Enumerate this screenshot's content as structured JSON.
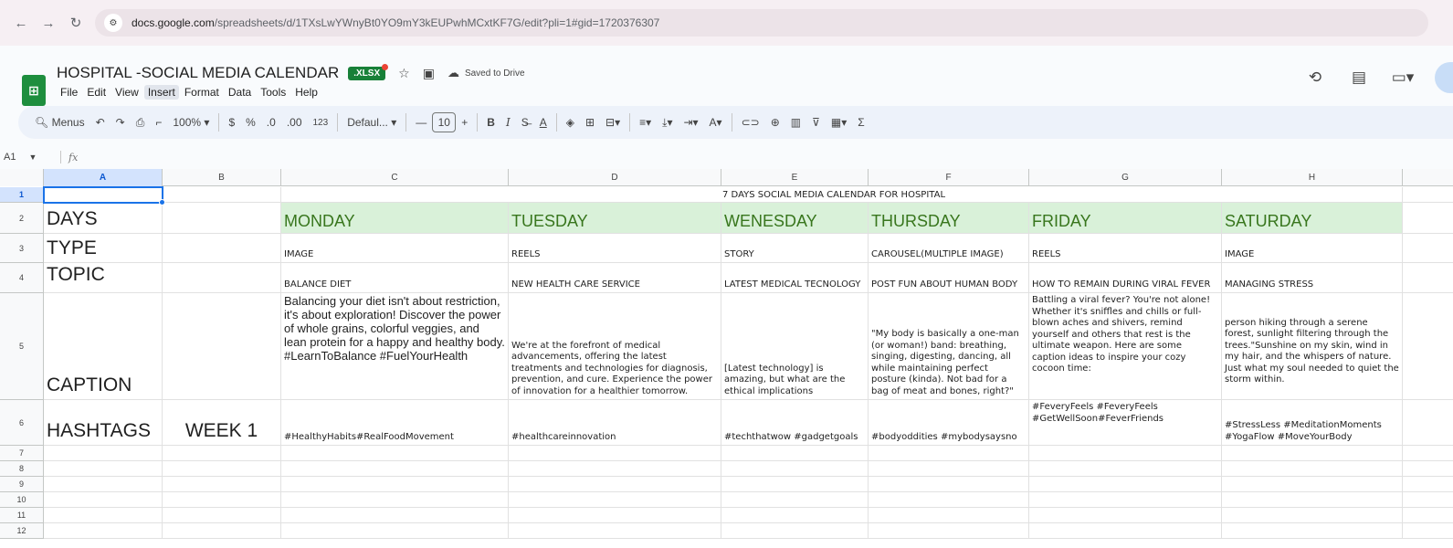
{
  "browser": {
    "url_host": "docs.google.com",
    "url_path": "/spreadsheets/d/1TXsLwYWnyBt0YO9mY3kEUPwhMCxtKF7G/edit?pli=1#gid=1720376307"
  },
  "doc": {
    "title": "HOSPITAL -SOCIAL MEDIA CALENDAR",
    "badge": ".XLSX",
    "saved_status": "Saved to Drive"
  },
  "menu": [
    "File",
    "Edit",
    "View",
    "Insert",
    "Format",
    "Data",
    "Tools",
    "Help"
  ],
  "toolbar": {
    "menus_label": "Menus",
    "zoom": "100%",
    "currency": "$",
    "percent": "%",
    "dec_decrease": ".0",
    "dec_increase": ".00",
    "number_format": "123",
    "font_name": "Defaul...",
    "font_size": "10"
  },
  "formula": {
    "cell_ref": "A1",
    "fx": "fx"
  },
  "columns": [
    "A",
    "B",
    "C",
    "D",
    "E",
    "F",
    "G",
    "H"
  ],
  "rows": [
    "1",
    "2",
    "3",
    "4",
    "5",
    "6",
    "7",
    "8",
    "9",
    "10",
    "11",
    "12"
  ],
  "sheet": {
    "title": "7 DAYS SOCIAL MEDIA CALENDAR FOR HOSPITAL",
    "labels": {
      "days": "DAYS",
      "type": "TYPE",
      "topic": "TOPIC",
      "caption": "CAPTION",
      "hashtags": "HASHTAGS",
      "week": "WEEK 1"
    },
    "days": [
      "MONDAY",
      "TUESDAY",
      "WENESDAY",
      "THURSDAY",
      "FRIDAY",
      "SATURDAY"
    ],
    "types": [
      "IMAGE",
      "REELS",
      "STORY",
      "CAROUSEL(MULTIPLE IMAGE)",
      "REELS",
      "IMAGE"
    ],
    "topics": [
      "BALANCE DIET",
      "NEW HEALTH CARE SERVICE",
      "LATEST MEDICAL TECNOLOGY",
      "POST FUN ABOUT HUMAN BODY",
      "HOW TO REMAIN DURING VIRAL FEVER",
      "MANAGING STRESS"
    ],
    "captions": [
      "Balancing your diet isn't about restriction, it's about exploration! Discover the power of whole grains, colorful veggies, and lean protein for a happy and healthy body. #LearnToBalance #FuelYourHealth",
      "We're at the forefront of medical advancements, offering the latest treatments and technologies for diagnosis, prevention, and cure. Experience the power of innovation for a healthier tomorrow.",
      "[Latest technology] is amazing, but what are the ethical implications",
      "\"My body is basically a one-man (or woman!) band: breathing, singing, digesting, dancing, all while maintaining perfect posture (kinda). Not bad for a bag of meat and bones, right?\"",
      "Battling a viral fever? You're not alone! Whether it's sniffles and chills or full-blown aches and shivers, remind yourself and others that rest is the ultimate weapon. Here are some caption ideas to inspire your cozy cocoon time:",
      " person hiking through a serene forest, sunlight filtering through the trees.\"Sunshine on my skin, wind in my hair, and the whispers of nature. Just what my soul needed to quiet the storm within."
    ],
    "hashtags": [
      "#HealthyHabits#RealFoodMovement",
      "#healthcareinnovation",
      "#techthatwow #gadgetgoals",
      "#bodyoddities #mybodysaysno",
      "#FeveryFeels #FeveryFeels #GetWellSoon#FeverFriends",
      "#StressLess #MeditationMoments #YogaFlow #MoveYourBody"
    ]
  }
}
